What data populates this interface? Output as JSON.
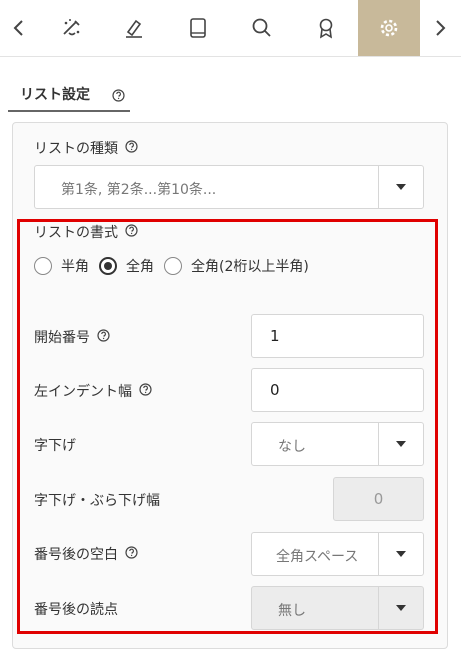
{
  "colors": {
    "active_tab_bg": "#c8b99a",
    "highlight_border": "#e00000"
  },
  "toolbar": {
    "icons": [
      "chevron-left-icon",
      "effects-icon",
      "pen-icon",
      "book-icon",
      "search-icon",
      "badge-icon",
      "gear-icon",
      "chevron-right-icon"
    ],
    "active": "gear-icon"
  },
  "tab": {
    "label": "リスト設定"
  },
  "list_type": {
    "label": "リストの種類",
    "value": "第1条, 第2条...第10条..."
  },
  "list_format": {
    "label": "リストの書式",
    "options": [
      "半角",
      "全角",
      "全角(2桁以上半角)"
    ],
    "selected": "全角"
  },
  "start_number": {
    "label": "開始番号",
    "value": "1"
  },
  "left_indent": {
    "label": "左インデント幅",
    "value": "0"
  },
  "hanging": {
    "label": "字下げ",
    "value": "なし"
  },
  "hanging_width": {
    "label": "字下げ・ぶら下げ幅",
    "value": "0"
  },
  "space_after": {
    "label": "番号後の空白",
    "value": "全角スペース"
  },
  "punct_after": {
    "label": "番号後の読点",
    "value": "無し"
  }
}
